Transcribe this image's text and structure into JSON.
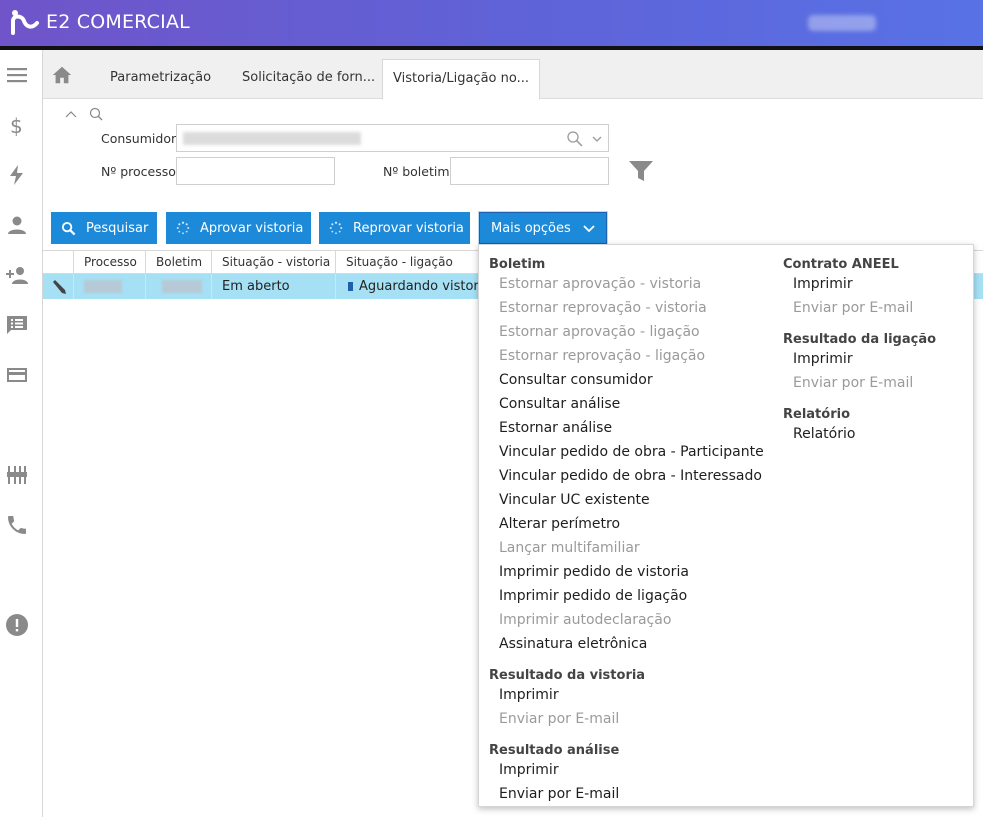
{
  "app": {
    "brand": "E2 COMERCIAL"
  },
  "tabs": [
    {
      "label": "Parametrização"
    },
    {
      "label": "Solicitação de forn..."
    },
    {
      "label": "Vistoria/Ligação no..."
    }
  ],
  "filters": {
    "consumidor_label": "Consumidor",
    "processo_label": "Nº processo",
    "boletim_label": "Nº boletim"
  },
  "toolbar": {
    "pesquisar": "Pesquisar",
    "aprovar": "Aprovar vistoria",
    "reprovar": "Reprovar vistoria",
    "mais": "Mais opções"
  },
  "grid": {
    "headers": [
      "Processo",
      "Boletim",
      "Situação - vistoria",
      "Situação - ligação"
    ],
    "row": {
      "situacao_vistoria": "Em aberto",
      "situacao_ligacao": "Aguardando vistoria"
    }
  },
  "menu": {
    "boletim": {
      "title": "Boletim",
      "items": [
        {
          "label": "Estornar aprovação - vistoria",
          "disabled": true
        },
        {
          "label": "Estornar reprovação - vistoria",
          "disabled": true
        },
        {
          "label": "Estornar aprovação - ligação",
          "disabled": true
        },
        {
          "label": "Estornar reprovação - ligação",
          "disabled": true
        },
        {
          "label": "Consultar consumidor",
          "disabled": false
        },
        {
          "label": "Consultar análise",
          "disabled": false
        },
        {
          "label": "Estornar análise",
          "disabled": false
        },
        {
          "label": "Vincular pedido de obra - Participante",
          "disabled": false
        },
        {
          "label": "Vincular pedido de obra - Interessado",
          "disabled": false
        },
        {
          "label": "Vincular UC existente",
          "disabled": false
        },
        {
          "label": "Alterar perímetro",
          "disabled": false
        },
        {
          "label": "Lançar multifamiliar",
          "disabled": true
        },
        {
          "label": "Imprimir pedido de vistoria",
          "disabled": false
        },
        {
          "label": "Imprimir pedido de ligação",
          "disabled": false
        },
        {
          "label": "Imprimir autodeclaração",
          "disabled": true
        },
        {
          "label": "Assinatura eletrônica",
          "disabled": false
        }
      ]
    },
    "resultado_vistoria": {
      "title": "Resultado da vistoria",
      "items": [
        {
          "label": "Imprimir",
          "disabled": false
        },
        {
          "label": "Enviar por E-mail",
          "disabled": true
        }
      ]
    },
    "resultado_analise": {
      "title": "Resultado análise",
      "items": [
        {
          "label": "Imprimir",
          "disabled": false
        },
        {
          "label": "Enviar por E-mail",
          "disabled": false
        }
      ]
    },
    "contrato_aneel": {
      "title": "Contrato ANEEL",
      "items": [
        {
          "label": "Imprimir",
          "disabled": false
        },
        {
          "label": "Enviar por E-mail",
          "disabled": true
        }
      ]
    },
    "resultado_ligacao": {
      "title": "Resultado da ligação",
      "items": [
        {
          "label": "Imprimir",
          "disabled": false
        },
        {
          "label": "Enviar por E-mail",
          "disabled": true
        }
      ]
    },
    "relatorio": {
      "title": "Relatório",
      "items": [
        {
          "label": "Relatório",
          "disabled": false
        }
      ]
    }
  },
  "icons": {
    "sidebar": [
      "menu-icon",
      "dollar-icon",
      "lightning-icon",
      "person-icon",
      "add-person-icon",
      "message-list-icon",
      "card-icon",
      "equalizer-icon",
      "phone-icon",
      "alert-icon"
    ]
  },
  "colors": {
    "header_start": "#6f55c9",
    "header_end": "#5872e6",
    "button": "#1d8ad9",
    "row_selected": "#a6e0f5"
  }
}
